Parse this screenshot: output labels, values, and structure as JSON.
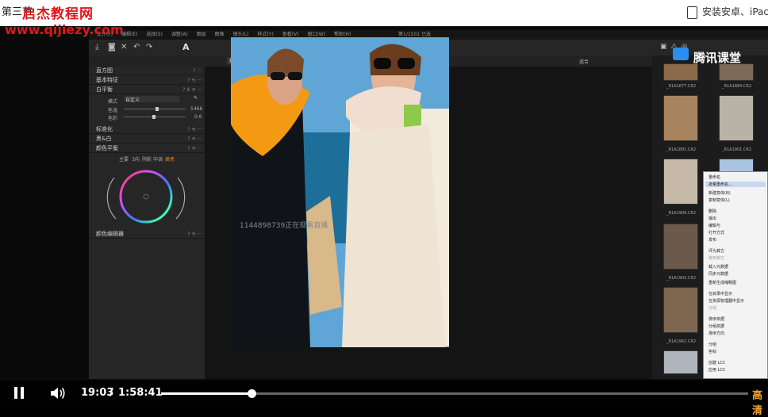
{
  "browser": {
    "page_title": "第三节",
    "watermark_site_name": "启杰教程网",
    "watermark_url": "www.qijiezy.com",
    "right_text": "安装安卓、iPac"
  },
  "app": {
    "menu": [
      "文件(F)",
      "编辑(E)",
      "选择(S)",
      "调整(A)",
      "图层",
      "图像",
      "镜头(L)",
      "样式(Y)",
      "查看(V)",
      "窗口(W)",
      "帮助(H)"
    ],
    "window_title": "第1/1501 已选",
    "left_panel": {
      "sections": [
        {
          "label": "直方图"
        },
        {
          "label": "基本特征"
        },
        {
          "label": "白平衡"
        },
        {
          "label": "标准化"
        },
        {
          "label": "黑&白"
        },
        {
          "label": "颜色平衡"
        },
        {
          "label": "颜色编辑器"
        }
      ],
      "wb_mode_label": "模式",
      "wb_mode_value": "自定义",
      "wb_kelvin_label": "色温",
      "wb_kelvin_value": "5466",
      "wb_tint_label": "色彩",
      "wb_tint_value": "0.6",
      "color_tabs": [
        "主要",
        "3向",
        "阴影",
        "中调",
        "高亮"
      ],
      "color_tab_active": "高亮"
    },
    "viewer_preset": "默认",
    "viewer_right_label": "适合"
  },
  "thumbnails": [
    {
      "caption": "_R1A1877.CR2"
    },
    {
      "caption": "_R1A1884.CR2"
    },
    {
      "caption": "_R1A1891.CR2"
    },
    {
      "caption": "_R1A1901.CR2"
    },
    {
      "caption": "_R1A1909.CR2"
    },
    {
      "caption": "_R1A1903.CR2"
    },
    {
      "caption": "_R1A1962.CR2"
    }
  ],
  "context_menu": {
    "items": [
      "重命名",
      "批量重命名...",
      "新建变体(N)",
      "复制变体(L)",
      "",
      "删除",
      "输出",
      "编辑与",
      "打开方式",
      "发布",
      "",
      "评为其它",
      "移到其它",
      "载入元数据",
      "同步元数据",
      "重新生成缩略图",
      "",
      "在目录中显示",
      "在资源管理器中显示",
      "分组",
      "",
      "排序依据",
      "分组依据",
      "排序方向",
      "",
      "分组",
      "色标",
      "",
      "创建 LCC",
      "应用 LCC"
    ],
    "selected": "批量重命名..."
  },
  "overlay_text": "1144898739正在观看直播",
  "brand_text": "腾讯课堂",
  "player": {
    "current_time": "19:03",
    "separator": "/",
    "total_time": "1:58:41",
    "progress_percent": 15.4,
    "quality_label": "高清"
  },
  "colors": {
    "accent": "#e0161e",
    "player_quality": "#f5a623"
  }
}
